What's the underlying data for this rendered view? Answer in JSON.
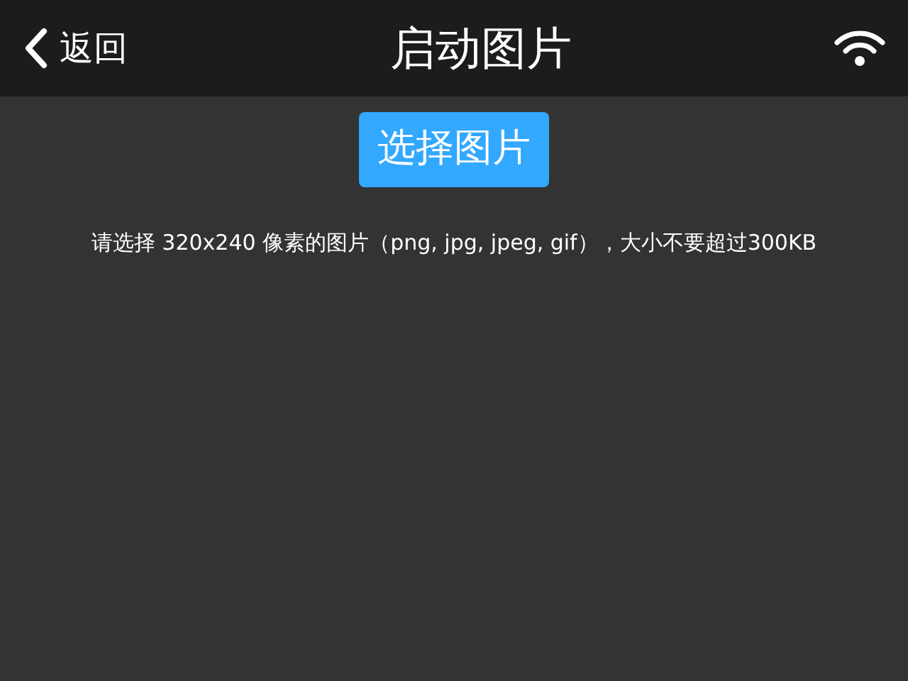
{
  "header": {
    "back_label": "返回",
    "title": "启动图片"
  },
  "select_button": "选择图片",
  "note": "请选择 320x240 像素的图片（png, jpg, jpeg, gif），大小不要超过300KB"
}
